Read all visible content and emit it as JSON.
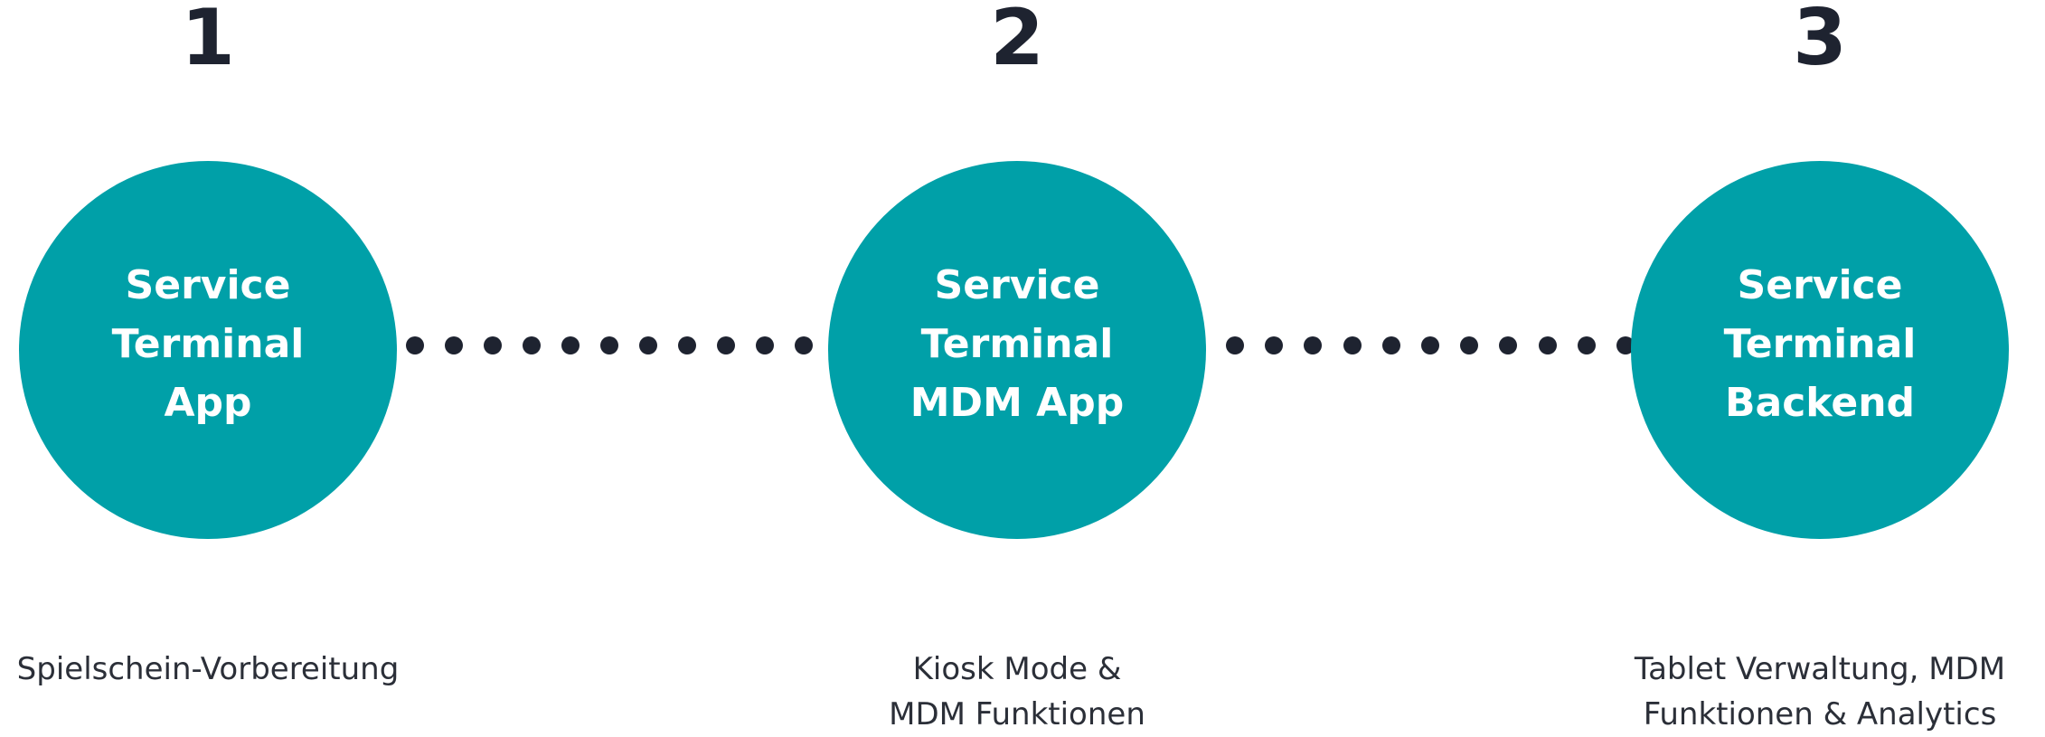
{
  "steps": [
    {
      "number": "1",
      "title": "Service\nTerminal\nApp",
      "description": "Spielschein-Vorbereitung"
    },
    {
      "number": "2",
      "title": "Service\nTerminal\nMDM App",
      "description": "Kiosk Mode &\nMDM Funktionen"
    },
    {
      "number": "3",
      "title": "Service\nTerminal\nBackend",
      "description": "Tablet Verwaltung, MDM\nFunktionen & Analytics"
    }
  ],
  "colors": {
    "circle": "#00a0a8",
    "number": "#1e2330",
    "dots": "#1e2330",
    "text": "#2b2f38"
  }
}
